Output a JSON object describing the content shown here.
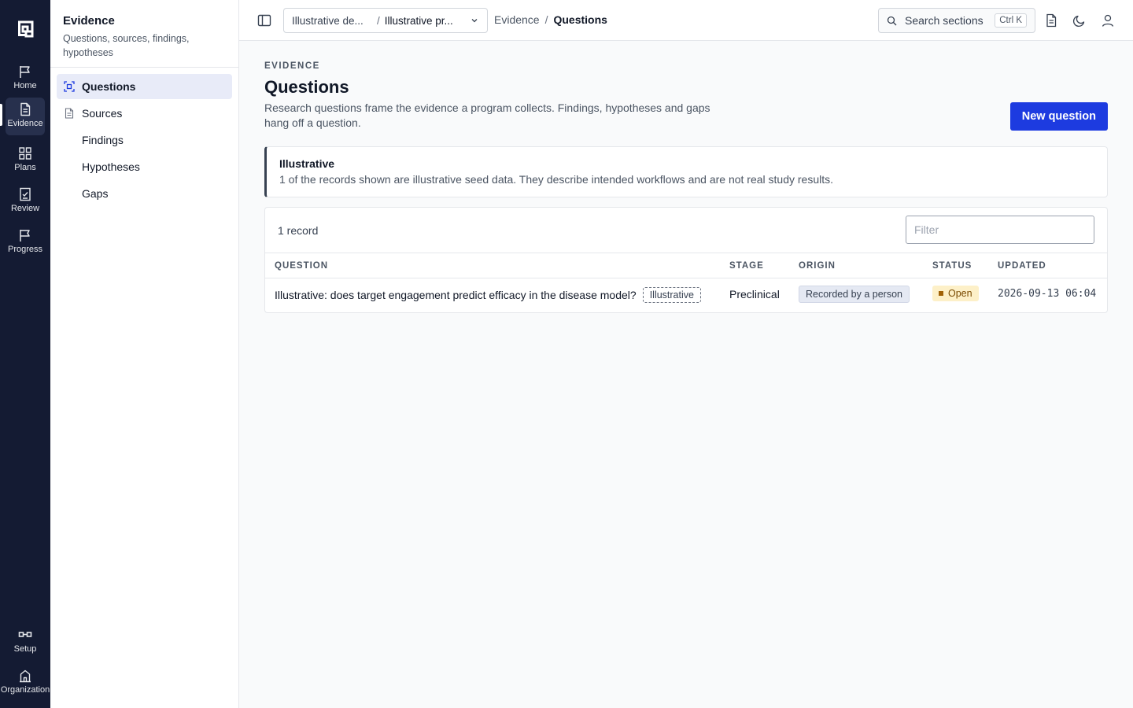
{
  "rail": {
    "items": [
      {
        "label": "Home",
        "icon": "flag-icon"
      },
      {
        "label": "Evidence",
        "icon": "document-icon"
      },
      {
        "label": "Plans",
        "icon": "grid-icon"
      },
      {
        "label": "Review",
        "icon": "checklist-icon"
      },
      {
        "label": "Progress",
        "icon": "flag-icon"
      }
    ],
    "bottom": [
      {
        "label": "Setup",
        "icon": "link-icon"
      },
      {
        "label": "Organization",
        "icon": "building-icon"
      }
    ],
    "active": "Evidence"
  },
  "sidebar": {
    "title": "Evidence",
    "subtitle": "Questions, sources, findings, hypotheses",
    "items": [
      {
        "label": "Questions",
        "active": true
      },
      {
        "label": "Sources"
      },
      {
        "label": "Findings"
      },
      {
        "label": "Hypotheses"
      },
      {
        "label": "Gaps"
      }
    ]
  },
  "topbar": {
    "context_a": "Illustrative de...",
    "context_sep": "/",
    "context_b": "Illustrative pr...",
    "breadcrumb": [
      "Evidence",
      "Questions"
    ],
    "breadcrumb_sep": "/",
    "search_placeholder": "Search sections",
    "search_shortcut": "Ctrl K"
  },
  "page": {
    "eyebrow": "EVIDENCE",
    "title": "Questions",
    "description": "Research questions frame the evidence a program collects. Findings, hypotheses and gaps hang off a question.",
    "new_button": "New question"
  },
  "notice": {
    "title": "Illustrative",
    "text": "1 of the records shown are illustrative seed data. They describe intended workflows and are not real study results."
  },
  "table": {
    "count": "1 record",
    "filter_placeholder": "Filter",
    "columns": [
      "QUESTION",
      "STAGE",
      "ORIGIN",
      "STATUS",
      "UPDATED"
    ],
    "rows": [
      {
        "question": "Illustrative: does target engagement predict efficacy in the disease model?",
        "tag": "Illustrative",
        "stage": "Preclinical",
        "origin": "Recorded by a person",
        "status": "Open",
        "updated": "2026-09-13 06:04"
      }
    ]
  },
  "colors": {
    "rail_bg": "#141b33",
    "primary": "#1d3be0",
    "status_open_bg": "#fdf0c8",
    "active_nav_bg": "#e8ebf8"
  }
}
